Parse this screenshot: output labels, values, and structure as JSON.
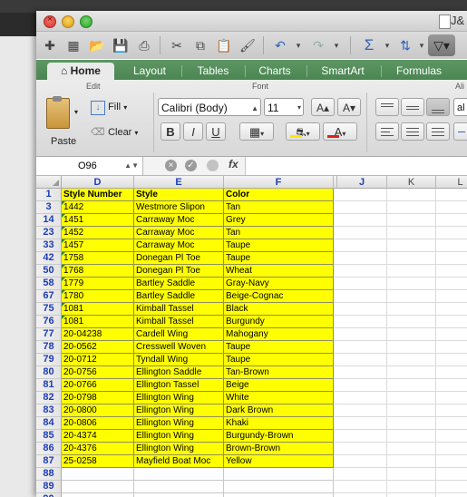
{
  "window": {
    "title": "J&"
  },
  "ribbon_tabs": [
    "Home",
    "Layout",
    "Tables",
    "Charts",
    "SmartArt",
    "Formulas"
  ],
  "ribbon": {
    "edit_group": "Edit",
    "font_group": "Font",
    "align_group": "Ali",
    "paste_label": "Paste",
    "fill_label": "Fill",
    "clear_label": "Clear",
    "font_name": "Calibri (Body)",
    "font_size": "11",
    "bold": "B",
    "italic": "I",
    "underline": "U",
    "wrap_partial": "al"
  },
  "formula_bar": {
    "name_box": "O96",
    "fx": "fx",
    "content": ""
  },
  "columns": [
    "D",
    "E",
    "F",
    "J",
    "K",
    "L"
  ],
  "header_row": {
    "row": "1",
    "cells": [
      "Style Number",
      "Style",
      "Color"
    ]
  },
  "rows": [
    {
      "row": "3",
      "cells": [
        "1442",
        "Westmore Slipon",
        "Tan"
      ]
    },
    {
      "row": "14",
      "cells": [
        "1451",
        "Carraway Moc",
        "Grey"
      ]
    },
    {
      "row": "23",
      "cells": [
        "1452",
        "Carraway Moc",
        "Tan"
      ]
    },
    {
      "row": "33",
      "cells": [
        "1457",
        "Carraway Moc",
        "Taupe"
      ]
    },
    {
      "row": "42",
      "cells": [
        "1758",
        "Donegan Pl Toe",
        "Taupe"
      ]
    },
    {
      "row": "50",
      "cells": [
        "1768",
        "Donegan Pl Toe",
        "Wheat"
      ]
    },
    {
      "row": "58",
      "cells": [
        "1779",
        "Bartley Saddle",
        "Gray-Navy"
      ]
    },
    {
      "row": "67",
      "cells": [
        "1780",
        "Bartley Saddle",
        "Beige-Cognac"
      ]
    },
    {
      "row": "75",
      "cells": [
        "1081",
        "Kimball Tassel",
        "Black"
      ]
    },
    {
      "row": "76",
      "cells": [
        "1081",
        "Kimball Tassel",
        "Burgundy"
      ]
    },
    {
      "row": "77",
      "cells": [
        "20-04238",
        "Cardell Wing",
        "Mahogany"
      ]
    },
    {
      "row": "78",
      "cells": [
        "20-0562",
        "Cresswell Woven",
        "Taupe"
      ]
    },
    {
      "row": "79",
      "cells": [
        "20-0712",
        "Tyndall Wing",
        "Taupe"
      ]
    },
    {
      "row": "80",
      "cells": [
        "20-0756",
        "Ellington Saddle",
        "Tan-Brown"
      ]
    },
    {
      "row": "81",
      "cells": [
        "20-0766",
        "Ellington Tassel",
        "Beige"
      ]
    },
    {
      "row": "82",
      "cells": [
        "20-0798",
        "Ellington Wing",
        "White"
      ]
    },
    {
      "row": "83",
      "cells": [
        "20-0800",
        "Ellington Wing",
        "Dark Brown"
      ]
    },
    {
      "row": "84",
      "cells": [
        "20-0806",
        "Ellington Wing",
        "Khaki"
      ]
    },
    {
      "row": "85",
      "cells": [
        "20-4374",
        "Ellington Wing",
        "Burgundy-Brown"
      ]
    },
    {
      "row": "86",
      "cells": [
        "20-4376",
        "Ellington Wing",
        "Brown-Brown"
      ]
    },
    {
      "row": "87",
      "cells": [
        "25-0258",
        "Mayfield Boat Moc",
        "Yellow"
      ]
    }
  ],
  "empty_rows": [
    "88",
    "89",
    "90"
  ],
  "colors": {
    "highlight": "#ffff00",
    "ribbon_green": "#4a8552",
    "header_blue": "#1d3db6"
  }
}
